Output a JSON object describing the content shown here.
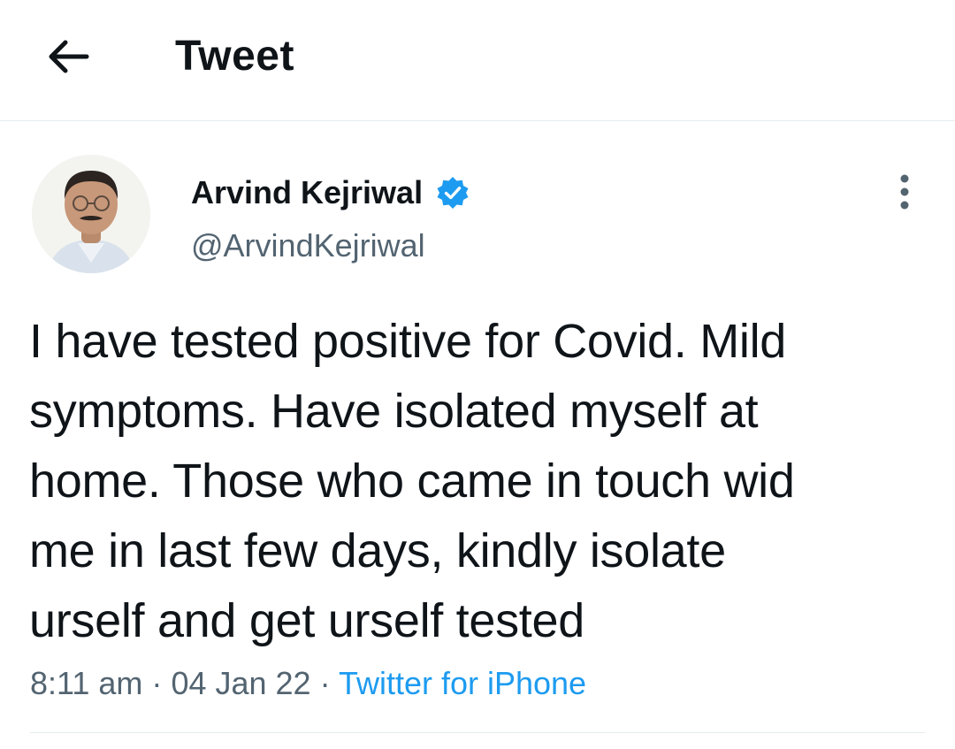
{
  "header": {
    "title": "Tweet",
    "back_icon": "arrow-left-icon"
  },
  "tweet": {
    "author": {
      "name": "Arvind Kejriwal",
      "handle": "@ArvindKejriwal",
      "verified": true,
      "verified_color": "#1d9bf0"
    },
    "text_lines": [
      "I have tested positive for Covid. Mild",
      "symptoms. Have isolated myself at",
      "home. Those who came in touch wid",
      "me in last few days, kindly isolate",
      "urself and get urself tested"
    ],
    "meta": {
      "time": "8:11 am",
      "separator": "·",
      "date": "04 Jan 22",
      "source": "Twitter for iPhone"
    },
    "more_icon": "more-vertical-icon"
  },
  "colors": {
    "text_primary": "#0f1419",
    "text_secondary": "#536471",
    "accent": "#1d9bf0",
    "divider": "#e6ecf0"
  }
}
